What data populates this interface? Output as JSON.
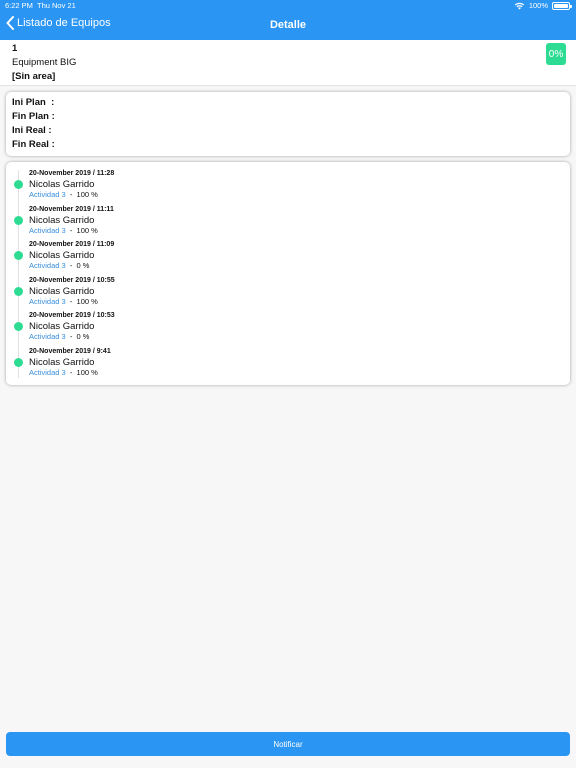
{
  "status_bar": {
    "time": "6:22 PM",
    "date": "Thu Nov 21",
    "battery": "100%"
  },
  "nav": {
    "back_label": "Listado de Equipos",
    "title": "Detalle"
  },
  "equipment": {
    "id": "1",
    "name": "Equipment BIG",
    "area": "[Sin area]",
    "progress": "0%"
  },
  "plan": [
    {
      "label": "Ini Plan",
      "value": ""
    },
    {
      "label": "Fin Plan",
      "value": ""
    },
    {
      "label": "Ini Real",
      "value": ""
    },
    {
      "label": "Fin Real",
      "value": ""
    }
  ],
  "timeline": [
    {
      "date": "20-November 2019 / 11:28",
      "name": "Nicolas Garrido",
      "activity": "Actividad 3",
      "percent": "100",
      "unit": "%"
    },
    {
      "date": "20-November 2019 / 11:11",
      "name": "Nicolas Garrido",
      "activity": "Actividad 3",
      "percent": "100",
      "unit": "%"
    },
    {
      "date": "20-November 2019 / 11:09",
      "name": "Nicolas Garrido",
      "activity": "Actividad 3",
      "percent": "0",
      "unit": "%"
    },
    {
      "date": "20-November 2019 / 10:55",
      "name": "Nicolas Garrido",
      "activity": "Actividad 3",
      "percent": "100",
      "unit": "%"
    },
    {
      "date": "20-November 2019 / 10:53",
      "name": "Nicolas Garrido",
      "activity": "Actividad 3",
      "percent": "0",
      "unit": "%"
    },
    {
      "date": "20-November 2019 / 9:41",
      "name": "Nicolas Garrido",
      "activity": "Actividad 3",
      "percent": "100",
      "unit": "%"
    }
  ],
  "actions": {
    "notify_label": "Notificar"
  },
  "colors": {
    "accent": "#2b95f3",
    "success": "#2edb93",
    "link": "#3a8fdc"
  }
}
